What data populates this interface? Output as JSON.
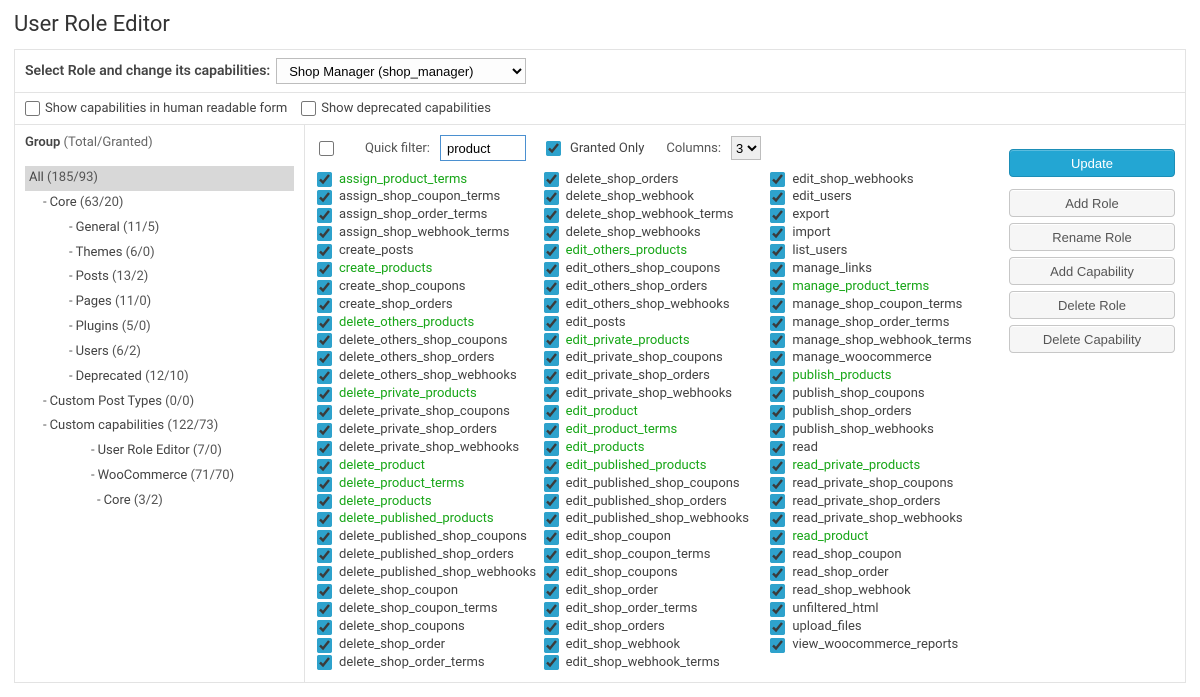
{
  "page_title": "User Role Editor",
  "role_row": {
    "label": "Select Role and change its capabilities:",
    "selected": "Shop Manager (shop_manager)"
  },
  "options_row": {
    "human_readable": "Show capabilities in human readable form",
    "deprecated": "Show deprecated capabilities"
  },
  "sidebar": {
    "title_strong": "Group",
    "title_muted": " (Total/Granted)",
    "items": [
      {
        "label": "All",
        "count": "(185/93)",
        "indent": 0,
        "selected": true,
        "dash": false
      },
      {
        "label": "Core",
        "count": "(63/20)",
        "indent": 1,
        "dash": true
      },
      {
        "label": "General",
        "count": "(11/5)",
        "indent": 2,
        "dash": true
      },
      {
        "label": "Themes",
        "count": "(6/0)",
        "indent": 2,
        "dash": true
      },
      {
        "label": "Posts",
        "count": "(13/2)",
        "indent": 2,
        "dash": true
      },
      {
        "label": "Pages",
        "count": "(11/0)",
        "indent": 2,
        "dash": true
      },
      {
        "label": "Plugins",
        "count": "(5/0)",
        "indent": 2,
        "dash": true
      },
      {
        "label": "Users",
        "count": "(6/2)",
        "indent": 2,
        "dash": true
      },
      {
        "label": "Deprecated",
        "count": "(12/10)",
        "indent": 2,
        "dash": true
      },
      {
        "label": "Custom Post Types",
        "count": "(0/0)",
        "indent": 1,
        "dash": true
      },
      {
        "label": "Custom capabilities",
        "count": "(122/73)",
        "indent": 1,
        "dash": true
      },
      {
        "label": "User Role Editor",
        "count": "(7/0)",
        "indent": 3,
        "dash": true
      },
      {
        "label": "WooCommerce",
        "count": "(71/70)",
        "indent": 3,
        "dash": true
      },
      {
        "label": "Core",
        "count": "(3/2)",
        "indent": 4,
        "dash": true
      }
    ]
  },
  "filter": {
    "quick_label": "Quick filter:",
    "value": "product",
    "granted_only": "Granted Only",
    "columns_label": "Columns:",
    "columns_value": "3"
  },
  "caps": [
    "assign_product_terms",
    "assign_shop_coupon_terms",
    "assign_shop_order_terms",
    "assign_shop_webhook_terms",
    "create_posts",
    "create_products",
    "create_shop_coupons",
    "create_shop_orders",
    "delete_others_products",
    "delete_others_shop_coupons",
    "delete_others_shop_orders",
    "delete_others_shop_webhooks",
    "delete_private_products",
    "delete_private_shop_coupons",
    "delete_private_shop_orders",
    "delete_private_shop_webhooks",
    "delete_product",
    "delete_product_terms",
    "delete_products",
    "delete_published_products",
    "delete_published_shop_coupons",
    "delete_published_shop_orders",
    "delete_published_shop_webhooks",
    "delete_shop_coupon",
    "delete_shop_coupon_terms",
    "delete_shop_coupons",
    "delete_shop_order",
    "delete_shop_order_terms",
    "delete_shop_orders",
    "delete_shop_webhook",
    "delete_shop_webhook_terms",
    "delete_shop_webhooks",
    "edit_others_products",
    "edit_others_shop_coupons",
    "edit_others_shop_orders",
    "edit_others_shop_webhooks",
    "edit_posts",
    "edit_private_products",
    "edit_private_shop_coupons",
    "edit_private_shop_orders",
    "edit_private_shop_webhooks",
    "edit_product",
    "edit_product_terms",
    "edit_products",
    "edit_published_products",
    "edit_published_shop_coupons",
    "edit_published_shop_orders",
    "edit_published_shop_webhooks",
    "edit_shop_coupon",
    "edit_shop_coupon_terms",
    "edit_shop_coupons",
    "edit_shop_order",
    "edit_shop_order_terms",
    "edit_shop_orders",
    "edit_shop_webhook",
    "edit_shop_webhook_terms",
    "edit_shop_webhooks",
    "edit_users",
    "export",
    "import",
    "list_users",
    "manage_links",
    "manage_product_terms",
    "manage_shop_coupon_terms",
    "manage_shop_order_terms",
    "manage_shop_webhook_terms",
    "manage_woocommerce",
    "publish_products",
    "publish_shop_coupons",
    "publish_shop_orders",
    "publish_shop_webhooks",
    "read",
    "read_private_products",
    "read_private_shop_coupons",
    "read_private_shop_orders",
    "read_private_shop_webhooks",
    "read_product",
    "read_shop_coupon",
    "read_shop_order",
    "read_shop_webhook",
    "unfiltered_html",
    "upload_files",
    "view_woocommerce_reports"
  ],
  "actions": {
    "update": "Update",
    "add_role": "Add Role",
    "rename_role": "Rename Role",
    "add_capability": "Add Capability",
    "delete_role": "Delete Role",
    "delete_capability": "Delete Capability"
  }
}
